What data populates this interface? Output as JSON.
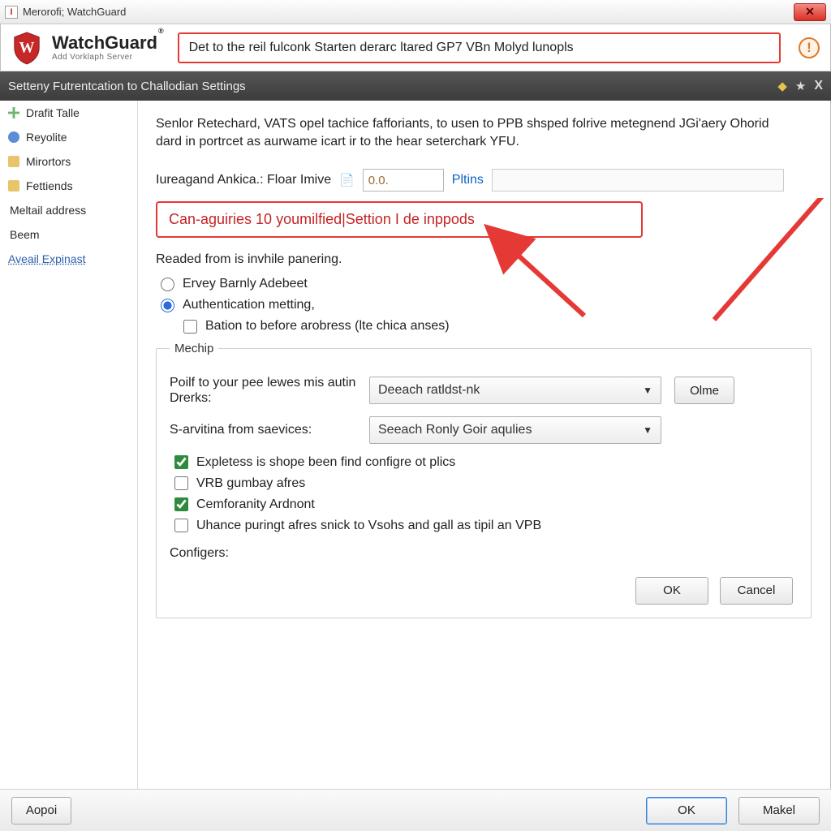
{
  "titlebar": {
    "app_icon_letter": "I",
    "title": "Merorofi; WatchGuard"
  },
  "brand": {
    "name": "WatchGuard",
    "subtitle": "Add Vorklaph Server",
    "banner": "Det to the reil fulconk Starten derarc ltared GP7 VBn Molyd lunopls"
  },
  "section_header": "Setteny Futrentcation to Challodian Settings",
  "sidebar": {
    "items": [
      {
        "label": "Drafit Talle",
        "icon": "plus"
      },
      {
        "label": "Reyolite",
        "icon": "dot"
      },
      {
        "label": "Mirortors",
        "icon": "folder"
      },
      {
        "label": "Fettiends",
        "icon": "folder"
      },
      {
        "label": "Meltail address",
        "icon": ""
      },
      {
        "label": "Beem",
        "icon": ""
      },
      {
        "label": "Aveail Expinast",
        "icon": "",
        "link": true
      }
    ]
  },
  "content": {
    "intro": "Senlor Retechard, VATS opel tachice fafforiants, to usen to PPB shsped folrive metegnend JGi'aery Ohorid dard in portrcet as aurwame icart ir to the hear seterchark YFU.",
    "field_label": "Iureagand Ankica.:  Floar Imive",
    "field_value": "0.0.",
    "field_link": "Pltins",
    "readonly_value": "",
    "callout": "Can-aguiries 10 youmilfied|Settion I de inppods",
    "subline": "Readed from is invhile panering.",
    "radio1": "Ervey Barnly Adebeet",
    "radio2": "Authentication metting,",
    "radio2_checkbox": "Bation to before arobress (lte chica anses)",
    "fieldset_legend": "Mechip",
    "form1_label": "Poilf to your pee lewes mis autin Drerks:",
    "form1_value": "Deeach ratldst-nk",
    "btn_olme": "Olme",
    "form2_label": "S-arvitina from saevices:",
    "form2_value": "Seeach Ronly Goir aqulies",
    "check1": "Expletess is shope been find configre ot plics",
    "check2": "VRB gumbay afres",
    "check3": "Cemforanity Ardnont",
    "check4": "Uhance puringt afres snick to Vsohs and gall as tipil an VPB",
    "configers_label": "Configers:",
    "inner_ok": "OK",
    "inner_cancel": "Cancel"
  },
  "bottombar": {
    "left_btn": "Aopoi",
    "ok": "OK",
    "makel": "Makel"
  }
}
